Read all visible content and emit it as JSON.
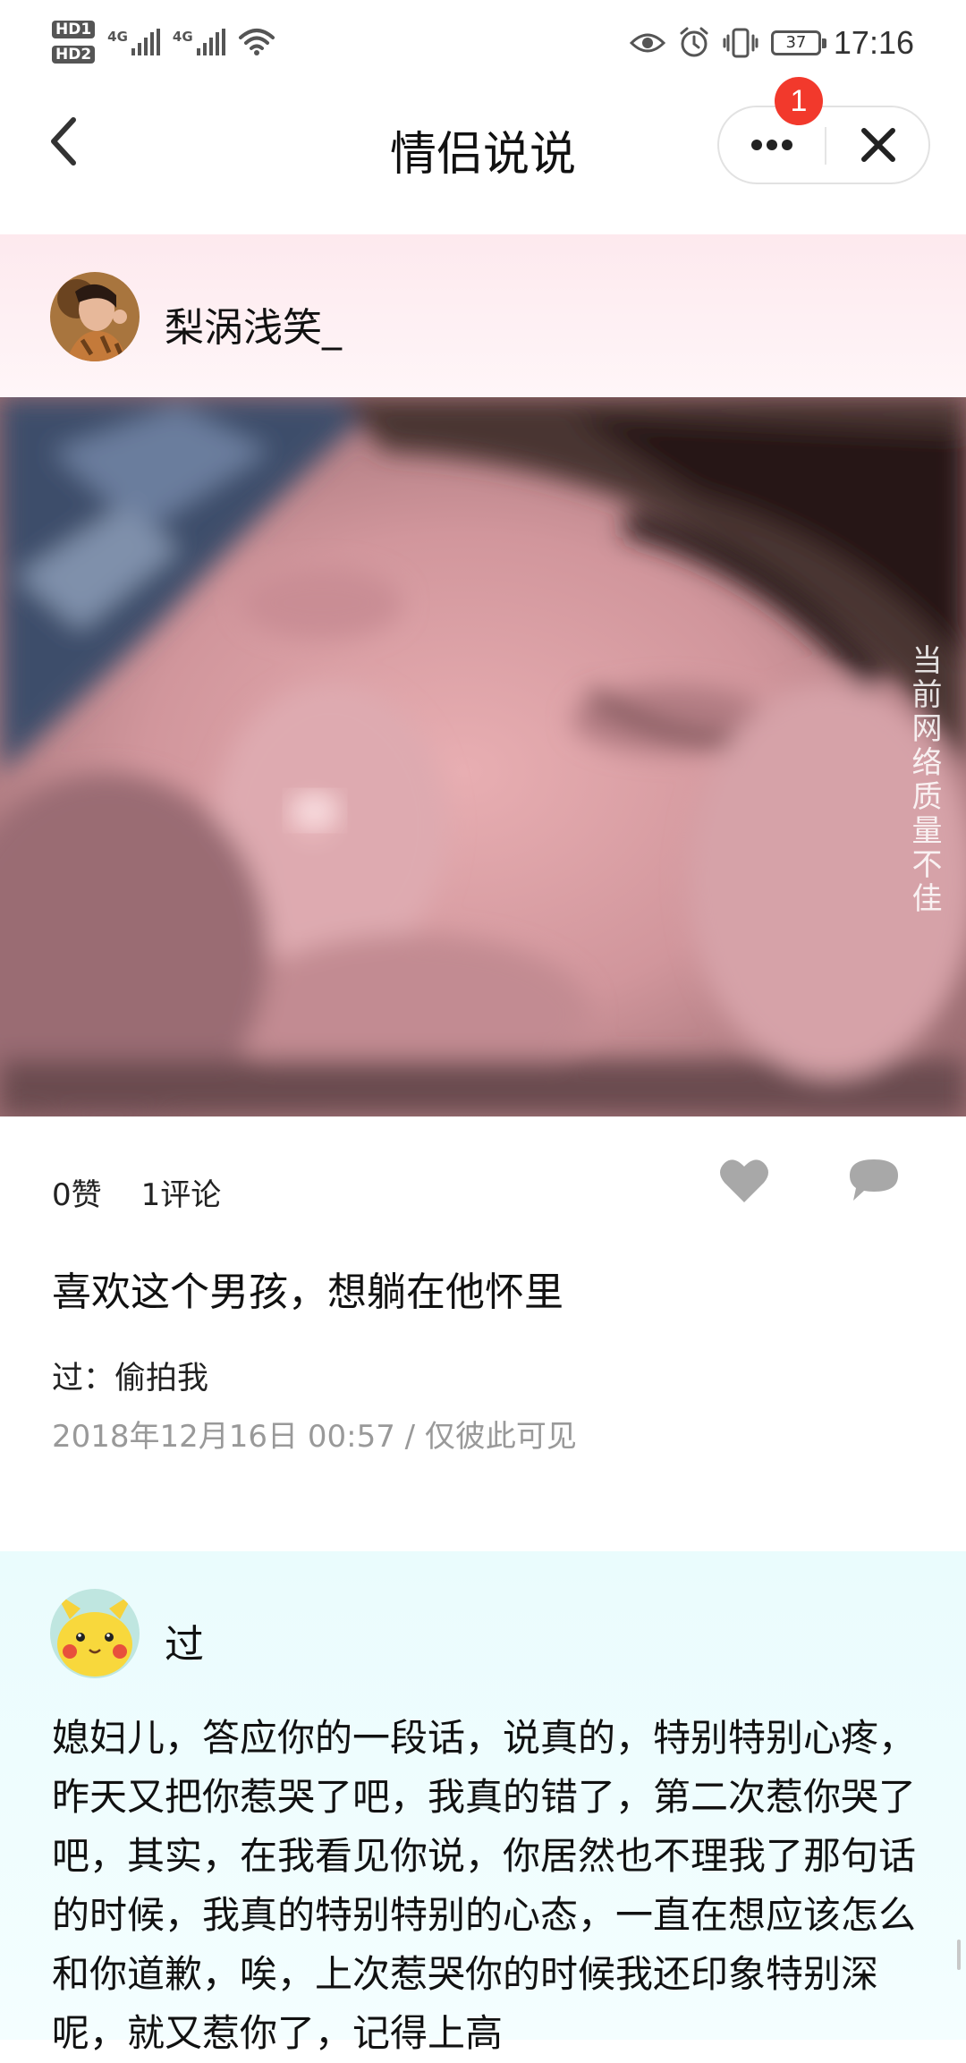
{
  "status_bar": {
    "hd1": "HD1",
    "hd2": "HD2",
    "net1": "4G",
    "net2": "4G",
    "battery": "37",
    "time": "17:16"
  },
  "nav": {
    "title": "情侣说说",
    "badge": "1"
  },
  "post": {
    "author": "梨涡浅笑_",
    "watermark": "当前网络质量不佳",
    "likes": "0赞",
    "comments": "1评论",
    "caption": "喜欢这个男孩，想躺在他怀里",
    "comment_line": "过：偷拍我",
    "meta": "2018年12月16日 00:57 / 仅彼此可见"
  },
  "post2": {
    "author": "过",
    "text": "媳妇儿，答应你的一段话，说真的，特别特别心疼，昨天又把你惹哭了吧，我真的错了，第二次惹你哭了吧，其实，在我看见你说，你居然也不理我了那句话的时候，我真的特别特别的心态，一直在想应该怎么和你道歉，唉，上次惹哭你的时候我还印象特别深呢，就又惹你了，记得上高"
  }
}
